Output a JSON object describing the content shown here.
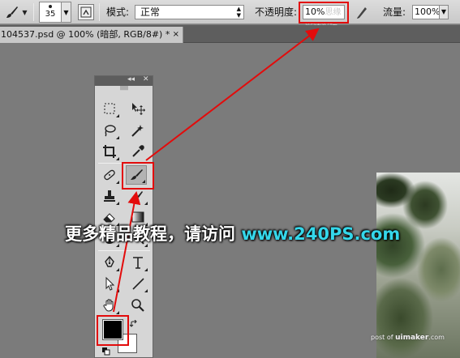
{
  "options_bar": {
    "brush_size": "35",
    "mode_label": "模式:",
    "mode_value": "正常",
    "opacity_label": "不透明度:",
    "opacity_value": "10%",
    "opacity_watermark": "思缘设计论坛",
    "flow_label": "流量:",
    "flow_value": "100%"
  },
  "document_tab": {
    "title": "104537.psd @ 100% (暗部, RGB/8#) *",
    "close_symbol": "×"
  },
  "tools_panel": {
    "collapse_symbol": "◂◂",
    "close_symbol": "✕",
    "active_tool": "brush-tool",
    "foreground_color": "#000000",
    "background_color": "#ffffff",
    "tools": [
      "rectangular-marquee-tool",
      "move-tool",
      "lasso-tool",
      "magic-wand-tool",
      "crop-tool",
      "eyedropper-tool",
      "spot-healing-brush-tool",
      "brush-tool",
      "clone-stamp-tool",
      "history-brush-tool",
      "eraser-tool",
      "gradient-tool",
      "blur-tool",
      "dodge-tool",
      "pen-tool",
      "type-tool",
      "path-selection-tool",
      "line-tool",
      "hand-tool",
      "zoom-tool"
    ]
  },
  "banner": {
    "text": "更多精品教程，请访问 ",
    "url": "www.240PS.com"
  },
  "credit": {
    "prefix": "post of ",
    "site": "uimaker",
    "suffix": ".com"
  },
  "annotation_color": "#e30b0b"
}
